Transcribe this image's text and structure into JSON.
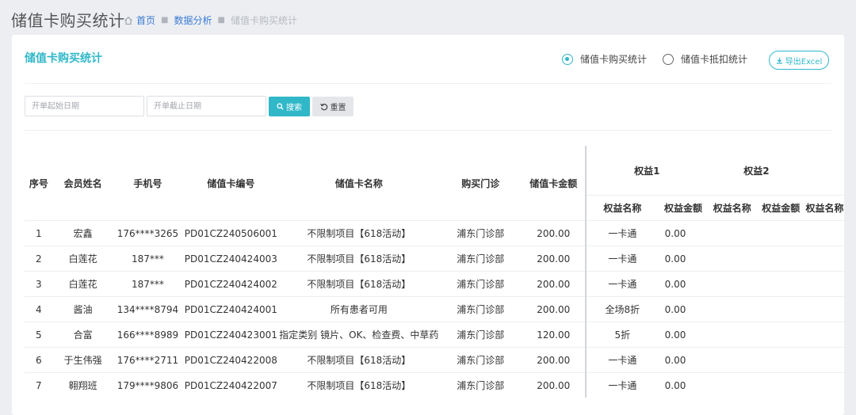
{
  "page": {
    "title": "储值卡购买统计",
    "breadcrumb": [
      "首页",
      "数据分析",
      "储值卡购买统计"
    ]
  },
  "panel": {
    "title": "储值卡购买统计",
    "radios": [
      {
        "label": "储值卡购买统计",
        "checked": true
      },
      {
        "label": "储值卡抵扣统计",
        "checked": false
      }
    ],
    "export_label": "导出Excel"
  },
  "filters": {
    "start_placeholder": "开单起始日期",
    "end_placeholder": "开单截止日期",
    "search_label": "搜索",
    "reset_label": "重置"
  },
  "table": {
    "headers": {
      "index": "序号",
      "member": "会员姓名",
      "phone": "手机号",
      "card_no": "储值卡编号",
      "card_name": "储值卡名称",
      "store": "购买门诊",
      "amount": "储值卡金额",
      "benefit1": "权益1",
      "benefit2": "权益2",
      "benefit_name": "权益名称",
      "benefit_amount": "权益金额"
    },
    "rows": [
      {
        "index": "1",
        "member": "宏鑫",
        "phone": "176****3265",
        "card_no": "PD01CZ240506001",
        "card_name": "不限制项目【618活动】",
        "store": "浦东门诊部",
        "amount": "200.00",
        "b1_name": "一卡通",
        "b1_amount": "0.00"
      },
      {
        "index": "2",
        "member": "白莲花",
        "phone": "187***",
        "card_no": "PD01CZ240424003",
        "card_name": "不限制项目【618活动】",
        "store": "浦东门诊部",
        "amount": "200.00",
        "b1_name": "一卡通",
        "b1_amount": "0.00"
      },
      {
        "index": "3",
        "member": "白莲花",
        "phone": "187***",
        "card_no": "PD01CZ240424002",
        "card_name": "不限制项目【618活动】",
        "store": "浦东门诊部",
        "amount": "200.00",
        "b1_name": "一卡通",
        "b1_amount": "0.00"
      },
      {
        "index": "4",
        "member": "酱油",
        "phone": "134****8794",
        "card_no": "PD01CZ240424001",
        "card_name": "所有患者可用",
        "store": "浦东门诊部",
        "amount": "200.00",
        "b1_name": "全场8折",
        "b1_amount": "0.00"
      },
      {
        "index": "5",
        "member": "合富",
        "phone": "166****8989",
        "card_no": "PD01CZ240423001",
        "card_name": "指定类别 镜片、OK、检查费、中草药",
        "store": "浦东门诊部",
        "amount": "120.00",
        "b1_name": "5折",
        "b1_amount": "0.00"
      },
      {
        "index": "6",
        "member": "于生伟强",
        "phone": "176****2711",
        "card_no": "PD01CZ240422008",
        "card_name": "不限制项目【618活动】",
        "store": "浦东门诊部",
        "amount": "200.00",
        "b1_name": "一卡通",
        "b1_amount": "0.00"
      },
      {
        "index": "7",
        "member": "翱翔班",
        "phone": "179****9806",
        "card_no": "PD01CZ240422007",
        "card_name": "不限制项目【618活动】",
        "store": "浦东门诊部",
        "amount": "200.00",
        "b1_name": "一卡通",
        "b1_amount": "0.00"
      }
    ]
  },
  "colors": {
    "accent": "#30b8c9",
    "link": "#3a7bd5"
  },
  "icons": [
    "home-icon",
    "download-icon",
    "search-icon",
    "refresh-icon"
  ]
}
